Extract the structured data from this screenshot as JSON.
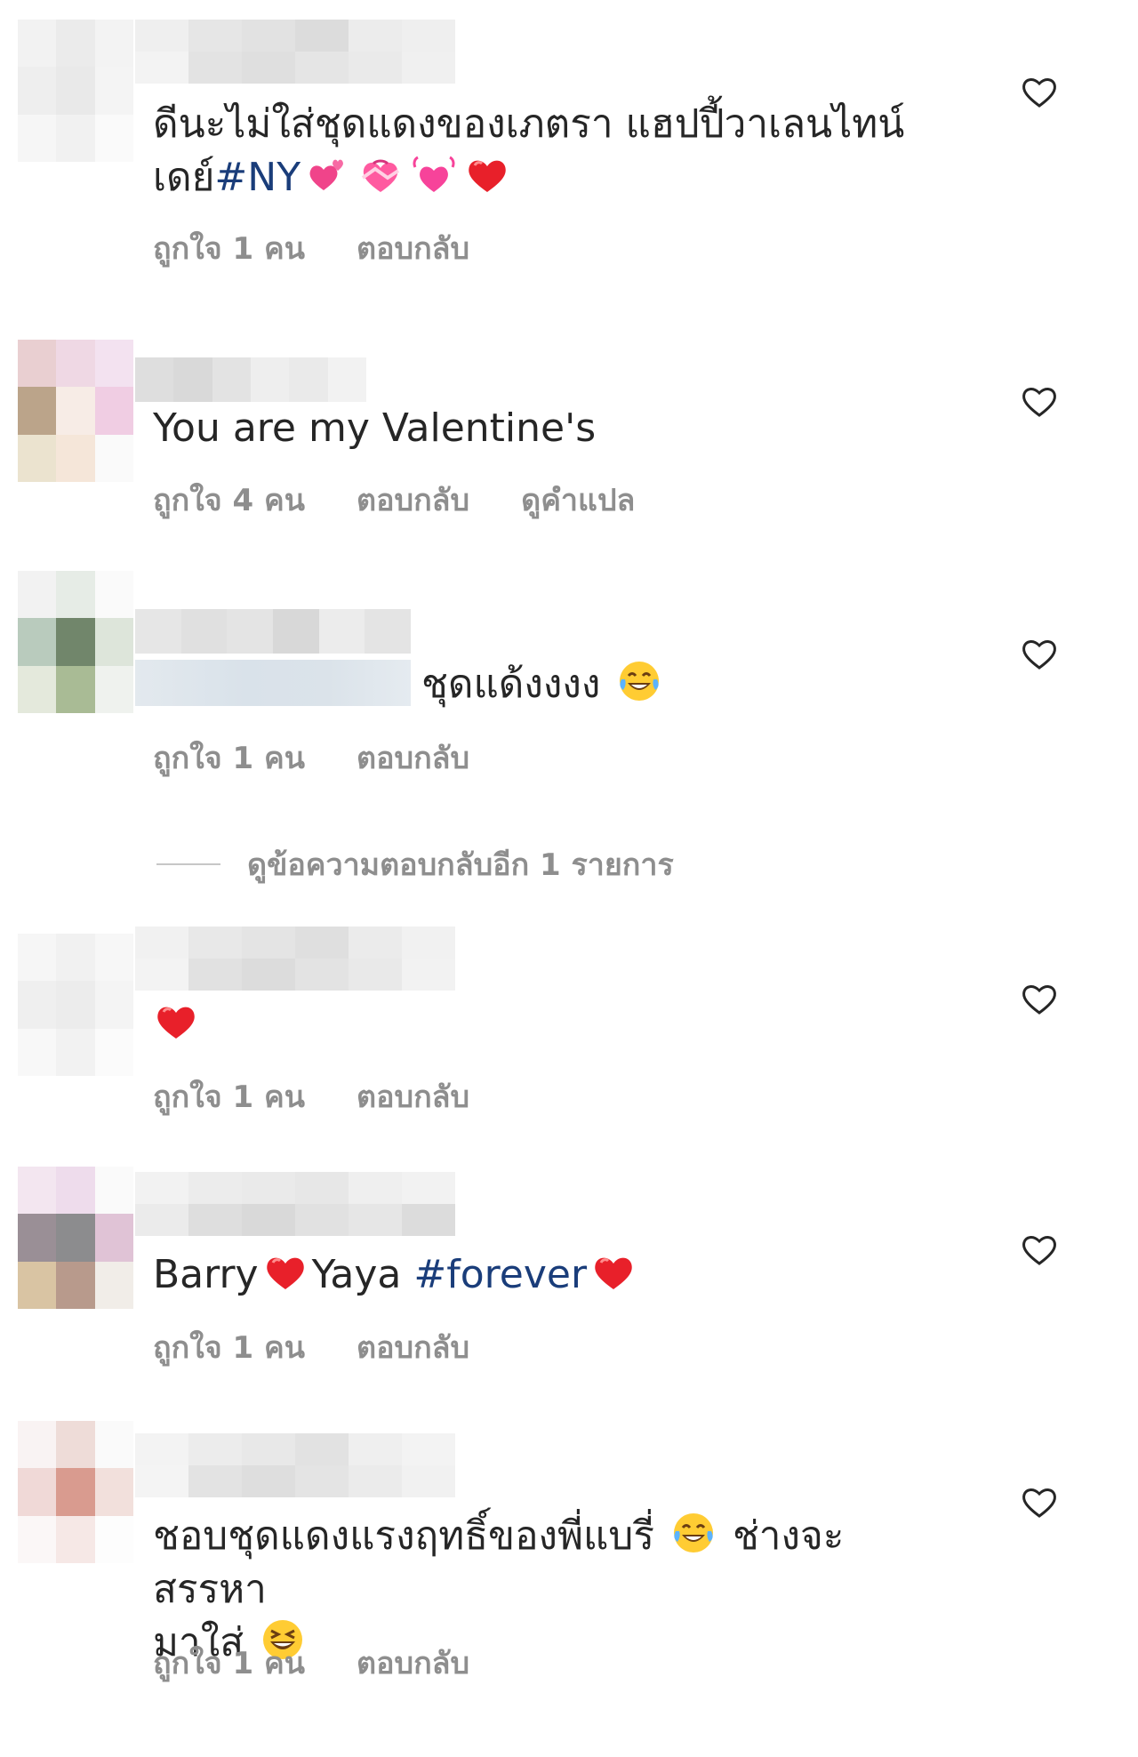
{
  "comments": [
    {
      "text": "ดีนะไม่ใส่ชุดแดงของเภตรา แฮปปี้วาเลนไทน์\nเดย์",
      "hashtag": "#NY",
      "likes_label": "ถูกใจ 1 คน",
      "reply_label": "ตอบกลับ"
    },
    {
      "text": "You are my Valentine's",
      "likes_label": "ถูกใจ 4 คน",
      "reply_label": "ตอบกลับ",
      "translate_label": "ดูคำแปล"
    },
    {
      "text": "ชุดแด้งงงง",
      "likes_label": "ถูกใจ 1 คน",
      "reply_label": "ตอบกลับ"
    },
    {
      "likes_label": "ถูกใจ 1 คน",
      "reply_label": "ตอบกลับ"
    },
    {
      "text_a": "Barry",
      "text_b": "Yaya ",
      "hashtag": "#forever",
      "likes_label": "ถูกใจ 1 คน",
      "reply_label": "ตอบกลับ"
    },
    {
      "text_a": "ชอบชุดแดงแรงฤทธิ์ของพี่แบรี่ ",
      "text_b": " ช่างจะสรรหา\nมาใส่ ",
      "likes_label": "ถูกใจ 1 คน",
      "reply_label": "ตอบกลับ"
    }
  ],
  "more_replies_label": "ดูข้อความตอบกลับอีก 1 รายการ",
  "icons": [
    "heart-outline-icon",
    "red-heart-emoji",
    "laughing-tears-emoji",
    "grinning-squint-emoji",
    "two-hearts-emoji",
    "heart-with-ribbon-emoji",
    "growing-heart-emoji"
  ],
  "colors": {
    "text": "#262626",
    "meta": "#8e8e8e",
    "hashtag": "#1a3d7a",
    "heart": "#e8202a"
  }
}
